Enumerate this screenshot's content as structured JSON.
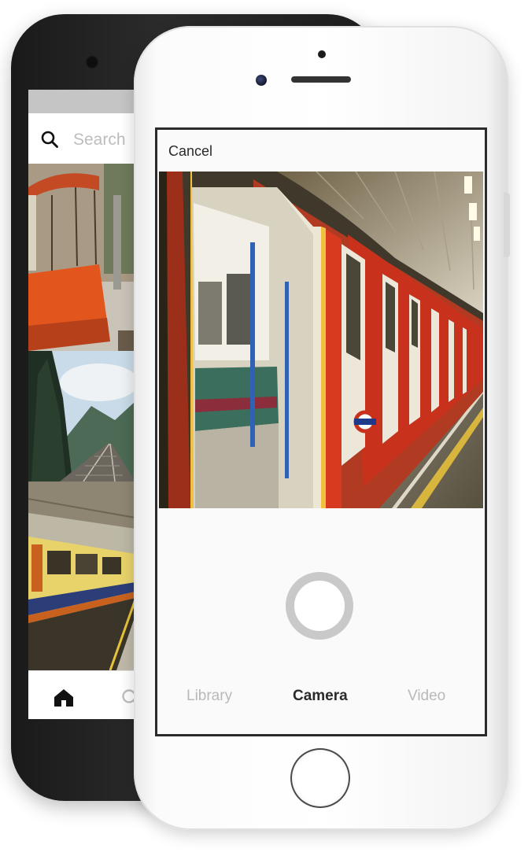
{
  "back_phone": {
    "search": {
      "placeholder": "Search",
      "icon": "search-icon"
    },
    "tabbar": {
      "icons": [
        "home-icon",
        "search-icon"
      ]
    }
  },
  "front_phone": {
    "header": {
      "cancel_label": "Cancel"
    },
    "mode_tabs": [
      {
        "label": "Library",
        "active": false
      },
      {
        "label": "Camera",
        "active": true
      },
      {
        "label": "Video",
        "active": false
      }
    ],
    "roundel_label": ""
  },
  "colors": {
    "active_tab": "#2a2a2a",
    "inactive_tab": "#b9b9b9",
    "shutter_ring": "#c9c9c9",
    "train_red": "#c8321c"
  }
}
